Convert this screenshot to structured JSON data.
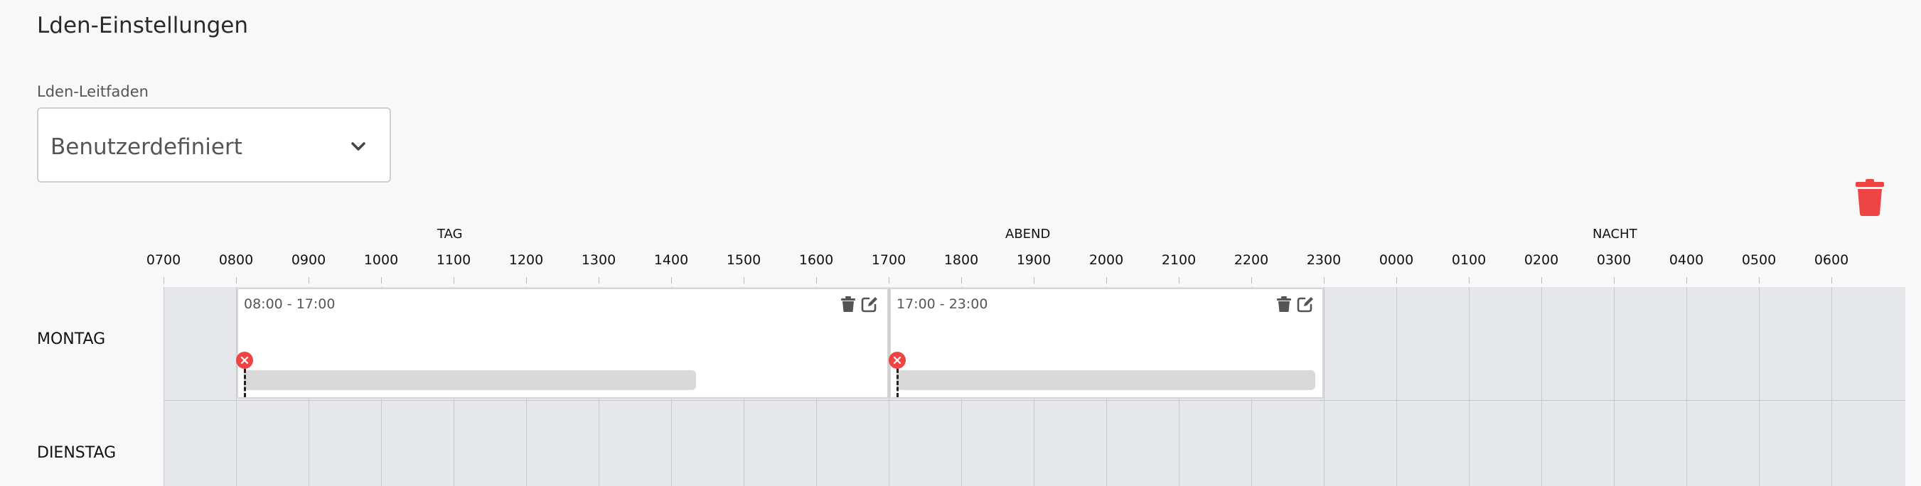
{
  "page": {
    "title": "Lden-Einstellungen"
  },
  "guideline": {
    "label": "Lden-Leitfaden",
    "value": "Benutzerdefiniert"
  },
  "period_groups": [
    "TAG",
    "ABEND",
    "NACHT"
  ],
  "hours": [
    "0700",
    "0800",
    "0900",
    "1000",
    "1100",
    "1200",
    "1300",
    "1400",
    "1500",
    "1600",
    "1700",
    "1800",
    "1900",
    "2000",
    "2100",
    "2200",
    "2300",
    "0000",
    "0100",
    "0200",
    "0300",
    "0400",
    "0500",
    "0600"
  ],
  "days": [
    "MONTAG",
    "DIENSTAG"
  ],
  "slots": [
    {
      "time": "08:00 - 17:00"
    },
    {
      "time": "17:00 - 23:00"
    }
  ],
  "colors": {
    "accent_red": "#ef4444",
    "grid_bg": "#e6e7ea"
  }
}
